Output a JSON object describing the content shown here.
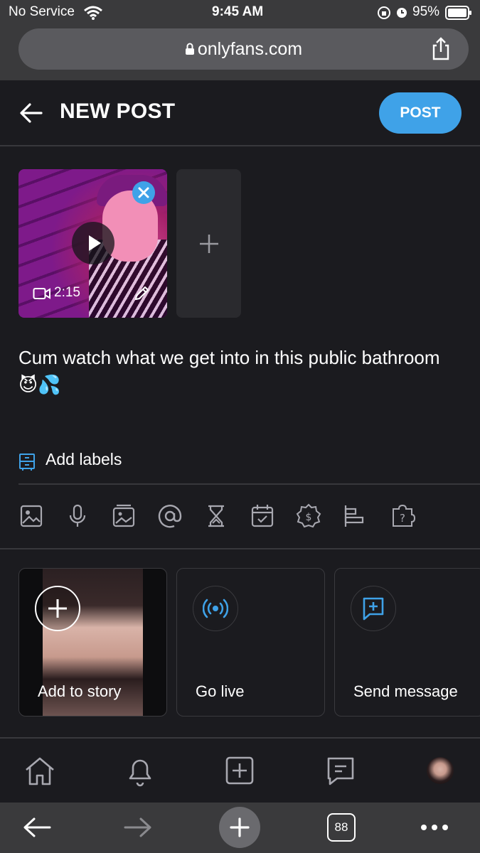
{
  "status_bar": {
    "carrier": "No Service",
    "time": "9:45 AM",
    "battery": "95%"
  },
  "browser": {
    "url": "onlyfans.com",
    "tabs_count": "88"
  },
  "header": {
    "title": "NEW POST",
    "post_label": "POST"
  },
  "media": {
    "duration": "2:15"
  },
  "post": {
    "text": "Cum watch what we get into in this public bathroom 😈💦"
  },
  "labels": {
    "add_labels": "Add labels"
  },
  "toolbar": {
    "icons": [
      "image-icon",
      "microphone-icon",
      "gallery-icon",
      "mention-icon",
      "hourglass-icon",
      "calendar-icon",
      "price-tag-icon",
      "poll-icon",
      "quiz-icon"
    ]
  },
  "quick_actions": {
    "add_to_story": "Add to story",
    "go_live": "Go live",
    "send_message": "Send message"
  },
  "colors": {
    "accent": "#3fa2e8",
    "background": "#1b1b1f",
    "browser_chrome": "#3a3a3c"
  }
}
